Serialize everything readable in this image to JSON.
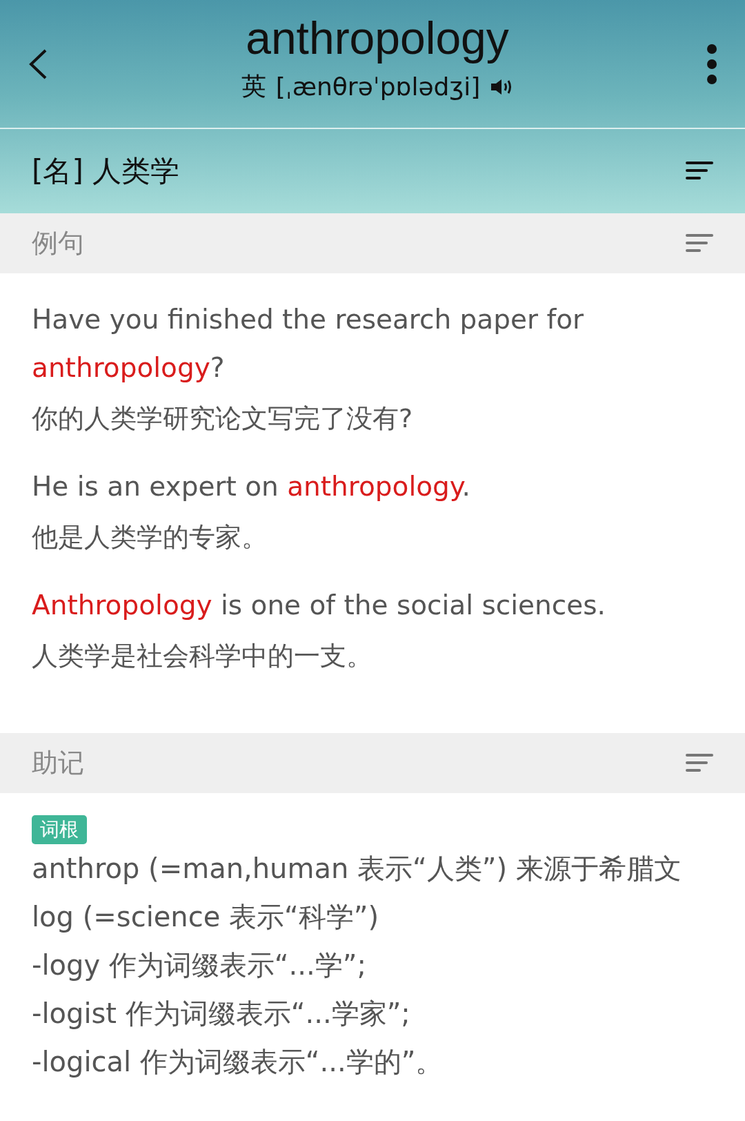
{
  "header": {
    "word": "anthropology",
    "phonetic_label": "英",
    "phonetic": "[ˌænθrəˈpɒlədʒi]"
  },
  "definition": "[名] 人类学",
  "examples_section": {
    "title": "例句",
    "examples": [
      {
        "english": [
          {
            "text": "Have you finished the research paper for ",
            "highlight": false
          },
          {
            "text": "anthropology",
            "highlight": true
          },
          {
            "text": "?",
            "highlight": false
          }
        ],
        "chinese": "你的人类学研究论文写完了没有?"
      },
      {
        "english": [
          {
            "text": "He is an expert on ",
            "highlight": false
          },
          {
            "text": "anthropology",
            "highlight": true
          },
          {
            "text": ".",
            "highlight": false
          }
        ],
        "chinese": "他是人类学的专家。"
      },
      {
        "english": [
          {
            "text": "Anthropology",
            "highlight": true
          },
          {
            "text": " is one of the social sciences.",
            "highlight": false
          }
        ],
        "chinese": "人类学是社会科学中的一支。"
      }
    ]
  },
  "mnemonic_section": {
    "title": "助记",
    "tag": "词根",
    "lines": [
      "anthrop (=man,human 表示“人类”) 来源于希腊文",
      "log (=science 表示“科学”)",
      "-logy 作为词缀表示“...学”;",
      "-logist 作为词缀表示“...学家”;",
      "-logical 作为词缀表示“...学的”。"
    ]
  }
}
